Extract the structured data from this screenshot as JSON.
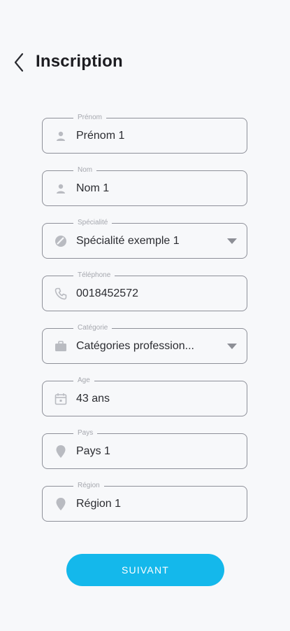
{
  "header": {
    "title": "Inscription"
  },
  "form": {
    "prenom": {
      "label": "Prénom",
      "value": "Prénom 1"
    },
    "nom": {
      "label": "Nom",
      "value": "Nom 1"
    },
    "specialite": {
      "label": "Spécialité",
      "value": "Spécialité exemple 1"
    },
    "telephone": {
      "label": "Téléphone",
      "value": "0018452572"
    },
    "categorie": {
      "label": "Catégorie",
      "value": "Catégories profession..."
    },
    "age": {
      "label": "Age",
      "value": "43 ans"
    },
    "pays": {
      "label": "Pays",
      "value": "Pays 1"
    },
    "region": {
      "label": "Région",
      "value": "Région 1"
    }
  },
  "actions": {
    "next_label": "SUIVANT"
  },
  "icons": {
    "back": "chevron-left-icon",
    "prenom": "user-icon",
    "nom": "user-icon",
    "specialite": "specialty-icon",
    "telephone": "phone-icon",
    "categorie": "briefcase-icon",
    "age": "calendar-icon",
    "pays": "location-pin-icon",
    "region": "location-pin-icon"
  },
  "colors": {
    "accent": "#14b8eb",
    "background": "#f7f8fa",
    "border": "#8e9099",
    "icon": "#b9bbc1"
  }
}
